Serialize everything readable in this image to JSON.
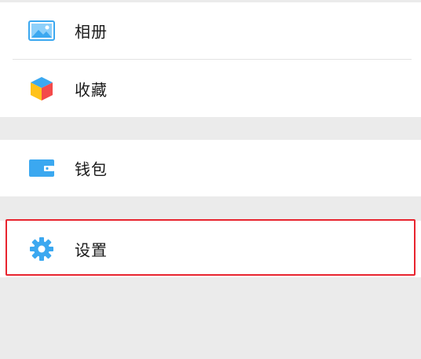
{
  "menu": {
    "album": {
      "label": "相册",
      "icon": "photo-album-icon",
      "icon_color": "#3ba8f0"
    },
    "favorites": {
      "label": "收藏",
      "icon": "favorites-cube-icon",
      "icon_colors": [
        "#f44a4a",
        "#ffc21a",
        "#3ba8f0"
      ]
    },
    "wallet": {
      "label": "钱包",
      "icon": "wallet-icon",
      "icon_color": "#3ba8f0"
    },
    "settings": {
      "label": "设置",
      "icon": "gear-icon",
      "icon_color": "#3ba8f0"
    }
  },
  "highlight_color": "#e8242f"
}
